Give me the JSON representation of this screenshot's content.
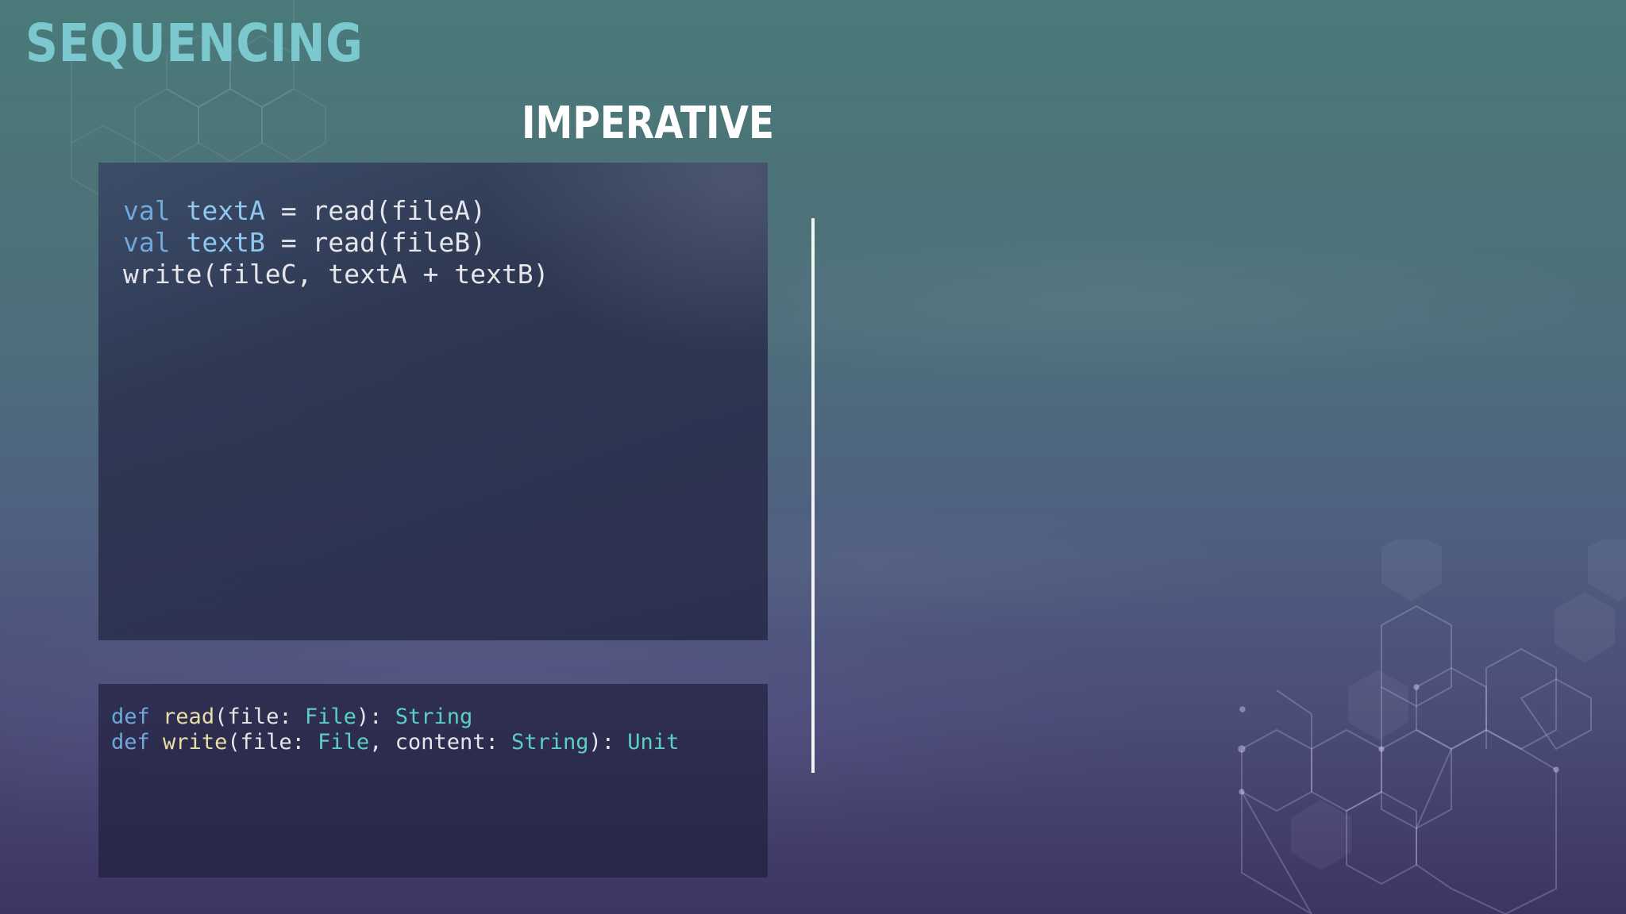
{
  "slide": {
    "title": "SEQUENCING",
    "column_title": "IMPERATIVE"
  },
  "main_code": {
    "line1": {
      "kw": "val",
      "var": "textA",
      "rest": " = read(fileA)"
    },
    "line2": {
      "kw": "val",
      "var": "textB",
      "rest": " = read(fileB)"
    },
    "line3": {
      "rest": "write(fileC, textA + textB)"
    }
  },
  "signatures": {
    "read": {
      "kw": "def",
      "name": "read",
      "open": "(file: ",
      "param_type": "File",
      "close": "): ",
      "return_type": "String"
    },
    "write": {
      "kw": "def",
      "name": "write",
      "open": "(file: ",
      "param_type1": "File",
      "mid": ", content: ",
      "param_type2": "String",
      "close": "): ",
      "return_type": "Unit"
    }
  },
  "colors": {
    "title": "#7cc8cf",
    "keyword": "#6fa8dc",
    "variable": "#8ec8f0",
    "function": "#e8dfa6",
    "type": "#5ccfc3",
    "divider": "#f4f4f6"
  }
}
